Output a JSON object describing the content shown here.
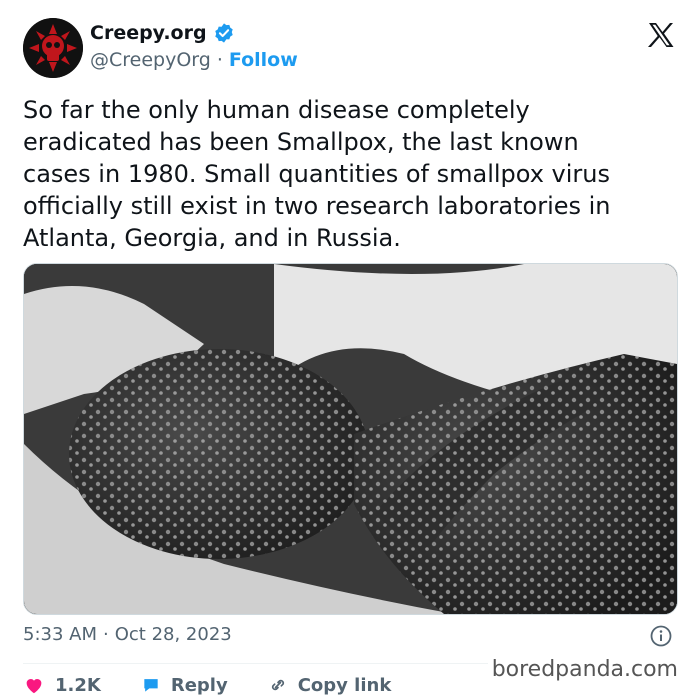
{
  "account": {
    "display_name": "Creepy.org",
    "handle": "@CreepyOrg",
    "separator": "·",
    "follow_label": "Follow"
  },
  "tweet": {
    "text": "So far the only human disease completely\neradicated has been Smallpox, the last known\ncases in 1980. Small quantities of smallpox virus\nofficially still exist in two research laboratories in\nAtlanta, Georgia, and in Russia.",
    "time": "5:33 AM",
    "separator": "·",
    "date": "Oct 28, 2023"
  },
  "actions": {
    "likes": "1.2K",
    "reply_label": "Reply",
    "copy_link_label": "Copy link"
  },
  "watermark": "boredpanda.com",
  "colors": {
    "accent": "#1d9bf0",
    "like": "#f91880",
    "text": "#0f1419",
    "muted": "#536471"
  },
  "icons": {
    "verified": "verified-badge-icon",
    "platform": "x-logo-icon",
    "info": "info-icon",
    "like": "heart-icon",
    "reply": "reply-icon",
    "copy": "link-icon"
  }
}
